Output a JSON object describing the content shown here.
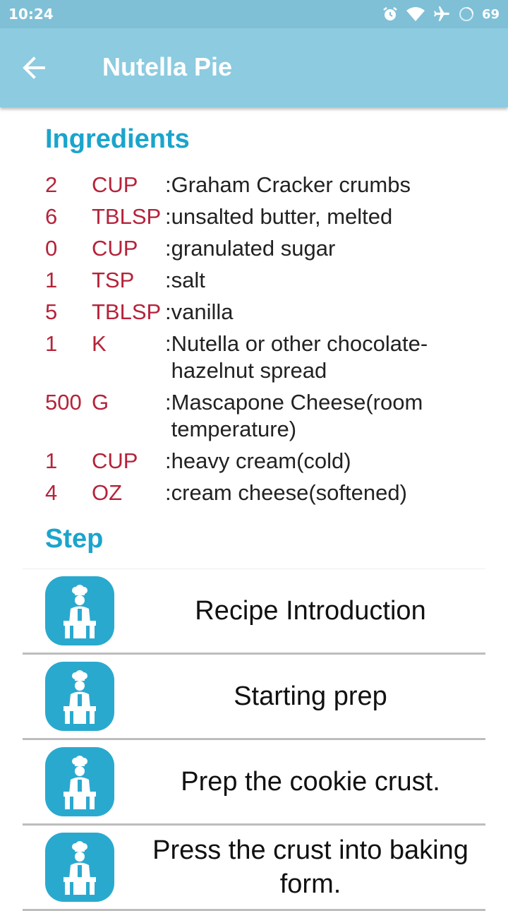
{
  "status_bar": {
    "time": "10:24",
    "battery": "69",
    "icons": [
      "alarm-icon",
      "wifi-icon",
      "airplane-icon",
      "battery-ring-icon"
    ]
  },
  "app_bar": {
    "title": "Nutella Pie",
    "back_icon": "arrow-left-icon",
    "background_color": "#8ccbe0"
  },
  "ingredients": {
    "title": "Ingredients",
    "items": [
      {
        "qty": "2",
        "unit": "CUP",
        "colon": ": ",
        "name": "Graham Cracker crumbs"
      },
      {
        "qty": "6",
        "unit": "TBLSP",
        "colon": ": ",
        "name": "unsalted butter, melted"
      },
      {
        "qty": "0",
        "unit": "CUP",
        "colon": ": ",
        "name": "granulated sugar"
      },
      {
        "qty": "1",
        "unit": "TSP",
        "colon": ": ",
        "name": "salt"
      },
      {
        "qty": "5",
        "unit": "TBLSP",
        "colon": ": ",
        "name": "vanilla"
      },
      {
        "qty": "1",
        "unit": "K",
        "colon": ": ",
        "name": "Nutella or other chocolate-hazelnut spread"
      },
      {
        "qty": "500",
        "unit": "G",
        "colon": ": ",
        "name": "Mascapone Cheese(room temperature)"
      },
      {
        "qty": "1",
        "unit": "CUP",
        "colon": ": ",
        "name": "heavy cream(cold)"
      },
      {
        "qty": "4",
        "unit": "OZ",
        "colon": ": ",
        "name": "cream cheese(softened)"
      }
    ]
  },
  "steps": {
    "title": "Step",
    "items": [
      {
        "label": "Recipe Introduction",
        "icon": "chef-icon"
      },
      {
        "label": "Starting prep",
        "icon": "chef-icon"
      },
      {
        "label": "Prep the cookie crust.",
        "icon": "chef-icon"
      },
      {
        "label": "Press the crust into baking form.",
        "icon": "chef-icon"
      }
    ]
  },
  "colors": {
    "accent": "#1ba4cc",
    "quantity": "#b5233a",
    "icon_bg": "#2aa9cf"
  }
}
